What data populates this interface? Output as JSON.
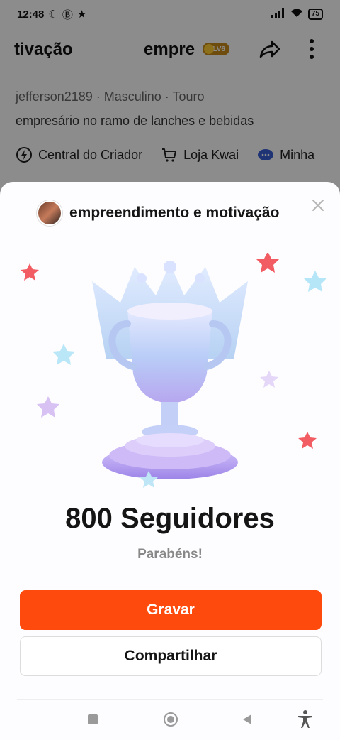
{
  "status_bar": {
    "time": "12:48",
    "battery": "75"
  },
  "background_header": {
    "title_left": "tivação",
    "title_center": "empre",
    "level_badge": "LV6"
  },
  "profile": {
    "meta": "jefferson2189 · Masculino · Touro",
    "bio": "empresário no ramo de lanches e bebidas",
    "quick_links": [
      {
        "label": "Central do Criador",
        "icon": "lightning-icon"
      },
      {
        "label": "Loja Kwai",
        "icon": "cart-icon"
      },
      {
        "label": "Minha",
        "icon": "chat-bubble-icon"
      }
    ]
  },
  "sheet": {
    "title": "empreendimento e motivação",
    "milestone": "800 Seguidores",
    "congrats": "Parabéns!",
    "primary_button": "Gravar",
    "secondary_button": "Compartilhar"
  },
  "colors": {
    "accent": "#fe4a0c",
    "badge": "#c98a19"
  }
}
